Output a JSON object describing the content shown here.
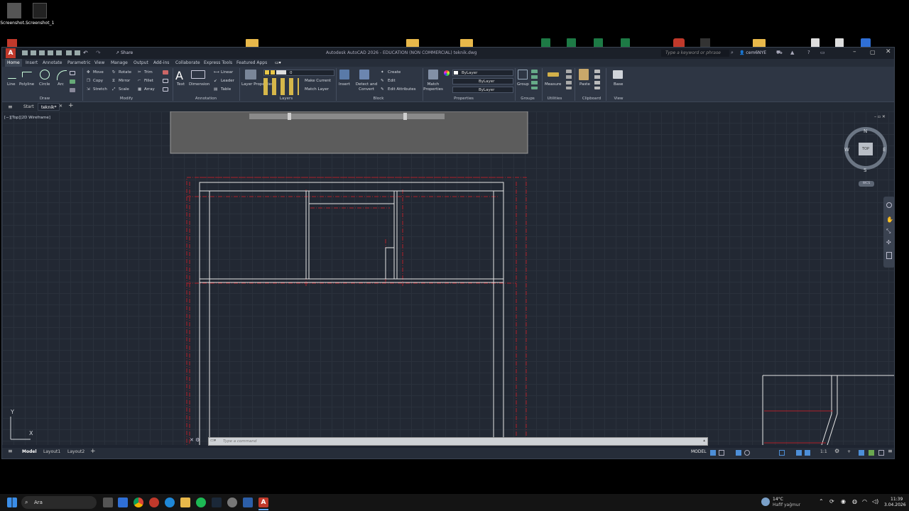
{
  "desktop": {
    "icons": [
      {
        "label": "Screenshot..."
      },
      {
        "label": "Screenshot_1"
      }
    ]
  },
  "window": {
    "title": "Autodesk AutoCAD 2026 - EDUCATION (NON COMMERCIAL)    teknik.dwg",
    "share_label": "Share",
    "search_placeholder": "Type a keyword or phrase",
    "user": "cem6NYE"
  },
  "ribbon_tabs": [
    "Home",
    "Insert",
    "Annotate",
    "Parametric",
    "View",
    "Manage",
    "Output",
    "Add-ins",
    "Collaborate",
    "Express Tools",
    "Featured Apps"
  ],
  "ribbon": {
    "draw": {
      "title": "Draw",
      "tools": [
        "Line",
        "Polyline",
        "Circle",
        "Arc"
      ]
    },
    "modify": {
      "title": "Modify",
      "tools": [
        "Move",
        "Rotate",
        "Trim",
        "Copy",
        "Mirror",
        "Fillet",
        "Stretch",
        "Scale",
        "Array"
      ]
    },
    "annotation": {
      "title": "Annotation",
      "tools": [
        "Text",
        "Dimension",
        "Linear",
        "Leader",
        "Table"
      ]
    },
    "layers": {
      "title": "Layers",
      "properties": "Layer Properties",
      "current_layer": "0",
      "make_current": "Make Current",
      "match_layer": "Match Layer"
    },
    "block": {
      "title": "Block",
      "insert": "Insert",
      "detect": "Detect and Convert",
      "create": "Create",
      "edit": "Edit",
      "edit_attributes": "Edit Attributes"
    },
    "properties": {
      "title": "Properties",
      "match": "Match Properties",
      "bylayer_color": "ByLayer",
      "bylayer_line": "ByLayer",
      "bylayer_weight": "ByLayer"
    },
    "groups": {
      "title": "Groups",
      "group": "Group"
    },
    "utilities": {
      "title": "Utilities",
      "measure": "Measure"
    },
    "clipboard": {
      "title": "Clipboard",
      "paste": "Paste"
    },
    "view": {
      "title": "View",
      "base": "Base"
    }
  },
  "file_tabs": [
    "Start",
    "teknik*"
  ],
  "viewport": {
    "label": "[−][Top][2D Wireframe]",
    "compass": {
      "n": "N",
      "s": "S",
      "e": "E",
      "w": "W",
      "top": "TOP"
    },
    "wcs": "WCS"
  },
  "command_line": {
    "placeholder": "Type a command"
  },
  "status": {
    "layout_tabs": [
      "Model",
      "Layout1",
      "Layout2"
    ],
    "model_label": "MODEL",
    "scale": "1:1"
  },
  "taskbar": {
    "search": "Ara",
    "weather_temp": "14°C",
    "weather_desc": "Hafif yağmur",
    "time": "11:39",
    "date": "3.04.2026"
  },
  "colors": {
    "accent": "#c0392b",
    "drawing_red": "#b0202a",
    "canvas": "#222833"
  }
}
